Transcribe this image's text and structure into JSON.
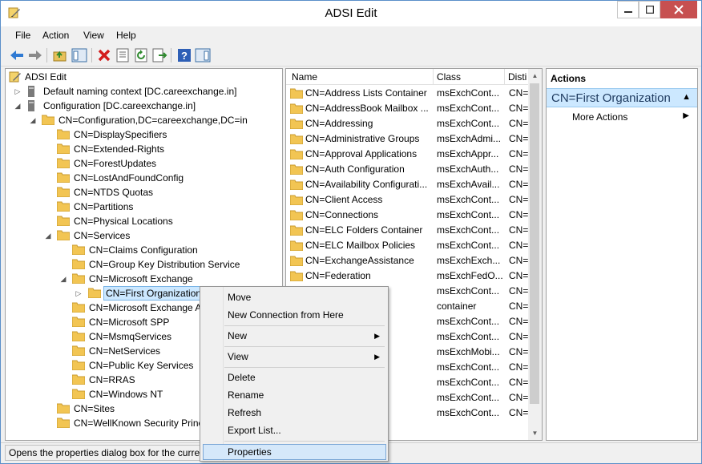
{
  "window": {
    "title": "ADSI Edit"
  },
  "menubar": {
    "items": [
      "File",
      "Action",
      "View",
      "Help"
    ]
  },
  "tree": {
    "root": "ADSI Edit",
    "nodes": [
      "Default naming context [DC.careexchange.in]",
      "Configuration [DC.careexchange.in]",
      "CN=Configuration,DC=careexchange,DC=in",
      "CN=DisplaySpecifiers",
      "CN=Extended-Rights",
      "CN=ForestUpdates",
      "CN=LostAndFoundConfig",
      "CN=NTDS Quotas",
      "CN=Partitions",
      "CN=Physical Locations",
      "CN=Services",
      "CN=Claims Configuration",
      "CN=Group Key Distribution Service",
      "CN=Microsoft Exchange",
      "CN=First Organization",
      "CN=Microsoft Exchange A",
      "CN=Microsoft SPP",
      "CN=MsmqServices",
      "CN=NetServices",
      "CN=Public Key Services",
      "CN=RRAS",
      "CN=Windows NT",
      "CN=Sites",
      "CN=WellKnown Security Princ"
    ]
  },
  "list": {
    "columns": [
      "Name",
      "Class",
      "Disti"
    ],
    "rows": [
      [
        "CN=Address Lists Container",
        "msExchCont...",
        "CN="
      ],
      [
        "CN=AddressBook Mailbox ...",
        "msExchCont...",
        "CN="
      ],
      [
        "CN=Addressing",
        "msExchCont...",
        "CN="
      ],
      [
        "CN=Administrative Groups",
        "msExchAdmi...",
        "CN="
      ],
      [
        "CN=Approval Applications",
        "msExchAppr...",
        "CN="
      ],
      [
        "CN=Auth Configuration",
        "msExchAuth...",
        "CN="
      ],
      [
        "CN=Availability Configurati...",
        "msExchAvail...",
        "CN="
      ],
      [
        "CN=Client Access",
        "msExchCont...",
        "CN="
      ],
      [
        "CN=Connections",
        "msExchCont...",
        "CN="
      ],
      [
        "CN=ELC Folders Container",
        "msExchCont...",
        "CN="
      ],
      [
        "CN=ELC Mailbox Policies",
        "msExchCont...",
        "CN="
      ],
      [
        "CN=ExchangeAssistance",
        "msExchExch...",
        "CN="
      ],
      [
        "CN=Federation",
        "msExchFedO...",
        "CN="
      ],
      [
        "sts",
        "msExchCont...",
        "CN="
      ],
      [
        "",
        "container",
        "CN="
      ],
      [
        "ration",
        "msExchCont...",
        "CN="
      ],
      [
        "x Policies",
        "msExchCont...",
        "CN="
      ],
      [
        "x Settings",
        "msExchMobi...",
        "CN="
      ],
      [
        "ttings",
        "msExchCont...",
        "CN="
      ],
      [
        "Policies",
        "msExchCont...",
        "CN="
      ],
      [
        "olicy Co...",
        "msExchCont...",
        "CN="
      ],
      [
        "",
        "msExchCont...",
        "CN="
      ]
    ]
  },
  "actions": {
    "header": "Actions",
    "selected": "CN=First Organization",
    "more": "More Actions"
  },
  "context_menu": {
    "move": "Move",
    "new_connection": "New Connection from Here",
    "new": "New",
    "view": "View",
    "delete": "Delete",
    "rename": "Rename",
    "refresh": "Refresh",
    "export": "Export List...",
    "properties": "Properties"
  },
  "status": {
    "text": "Opens the properties dialog box for the curre"
  }
}
